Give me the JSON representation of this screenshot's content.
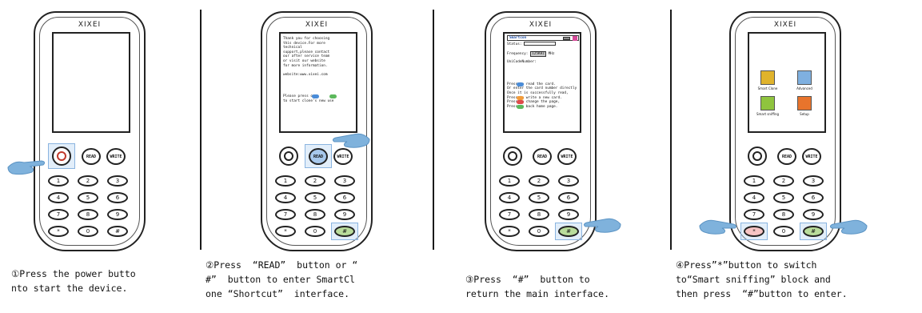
{
  "brand": "XIXEI",
  "keys": {
    "power": "",
    "read": "READ",
    "write": "WRITE",
    "digits": [
      "1",
      "2",
      "3",
      "4",
      "5",
      "6",
      "7",
      "8",
      "9",
      "*",
      "0",
      "#"
    ]
  },
  "captions": [
    "①Press the power butto\nnto start the device.",
    "②Press  “READ”  button or “\n#”  button to enter SmartCl\none “Shortcut”  interface.",
    "③Press  “#”  button to\nreturn the main interface.",
    "④Press”*”button to switch\nto“Smart sniffing” block and\nthen press  “#”button to enter."
  ],
  "screen2": {
    "lines": [
      "Thank you for choosing",
      "this device.For more",
      "technical",
      "support,please contact",
      "our after service team",
      "or visit our website",
      "for more information.",
      "",
      "website:www.xixei.com",
      "",
      "",
      "",
      "Please press    or",
      "to start clone's new use"
    ]
  },
  "screen3": {
    "title": "Smartcon",
    "status_label": "Status:",
    "frequency_label": "Frequency:",
    "frequency_value": "125KHz",
    "frequency_unit": "MHz",
    "uid_label": "UniCodeNumber:",
    "instructions": [
      "Press       to read the card.",
      "Or enter the card number directly",
      "Once it is successfully read,",
      "Press        to write a new card.",
      "Press      to change the page,",
      "Press      to back home page."
    ]
  },
  "screen4": {
    "tiles": [
      "Smart Clone",
      "Advanced",
      "Smart sniffing",
      "Setup"
    ]
  },
  "colors": {
    "highlight": "#8ab4e0",
    "pink_key": "#f7c4c4",
    "green_key": "#b9dc9b",
    "hand": "#7fb2dc"
  }
}
